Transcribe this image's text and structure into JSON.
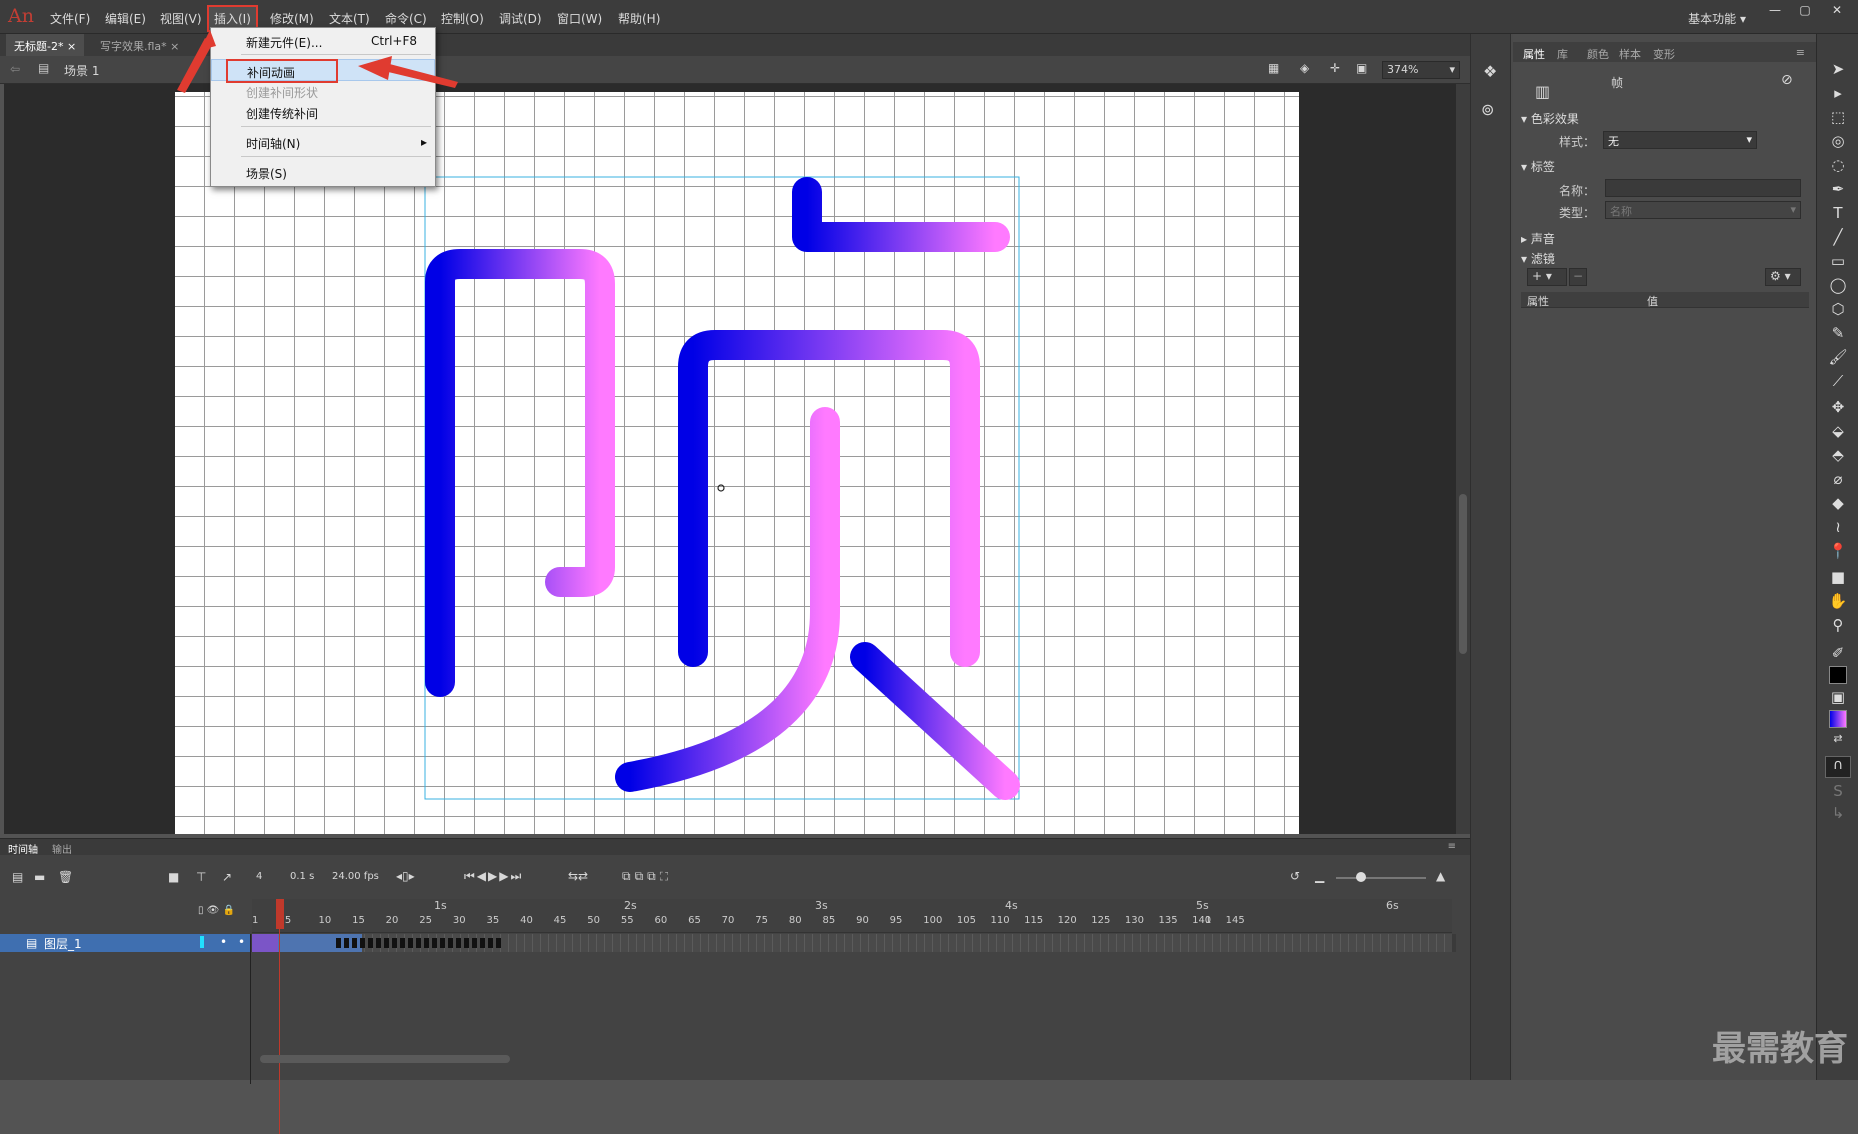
{
  "app": {
    "logo": "An",
    "workspace": "基本功能"
  },
  "menu": [
    "文件(F)",
    "编辑(E)",
    "视图(V)",
    "插入(I)",
    "修改(M)",
    "文本(T)",
    "命令(C)",
    "控制(O)",
    "调试(D)",
    "窗口(W)",
    "帮助(H)"
  ],
  "doc_tabs": [
    "无标题-2*",
    "写字效果.fla*"
  ],
  "scene": {
    "label": "场景 1",
    "zoom": "374%"
  },
  "dropdown": {
    "items": [
      {
        "label": "新建元件(E)...",
        "shortcut": "Ctrl+F8"
      },
      {
        "label": "补间动画"
      },
      {
        "label": "创建补间形状"
      },
      {
        "label": "创建传统补间"
      },
      {
        "label": "时间轴(N)",
        "arrow": "▸"
      },
      {
        "label": "场景(S)"
      }
    ]
  },
  "stage": {
    "glyph": "帧"
  },
  "timeline": {
    "tabs": [
      "时间轴",
      "输出"
    ],
    "frame": "4",
    "time": "0.1 s",
    "fps": "24.00 fps",
    "seconds": [
      "1s",
      "2s",
      "3s",
      "4s",
      "5s",
      "6s"
    ],
    "frame_numbers": [
      "1",
      "5",
      "10",
      "15",
      "20",
      "25",
      "30",
      "35",
      "40",
      "45",
      "50",
      "55",
      "60",
      "65",
      "70",
      "75",
      "80",
      "85",
      "90",
      "95",
      "100",
      "105",
      "110",
      "115",
      "120",
      "125",
      "130",
      "135",
      "140",
      "145",
      "1"
    ],
    "layer": "图层_1"
  },
  "properties": {
    "tabs": [
      "属性",
      "库",
      "颜色",
      "样本",
      "变形"
    ],
    "title": "帧",
    "sections": {
      "color_effect": "色彩效果",
      "label": "标签",
      "sound": "声音",
      "filter": "滤镜"
    },
    "style_label": "样式：",
    "style_value": "无",
    "name_label": "名称：",
    "type_label": "类型：",
    "type_placeholder": "名称",
    "col_prop": "属性",
    "col_value": "值"
  },
  "watermark": "最需教育"
}
